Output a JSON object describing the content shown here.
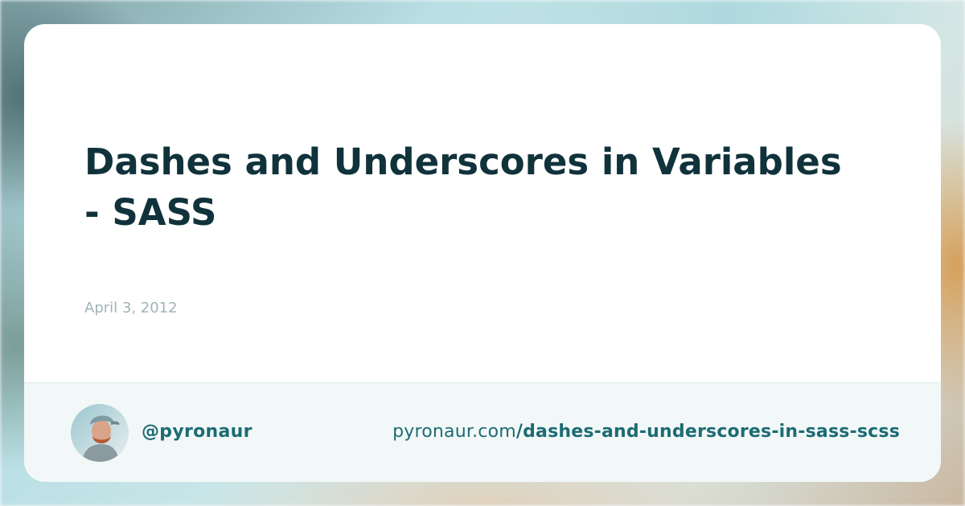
{
  "post": {
    "title": "Dashes and Underscores in Variables - SASS",
    "date": "April 3, 2012"
  },
  "footer": {
    "handle": "@pyronaur",
    "url_domain": "pyronaur.com",
    "url_path": "/dashes-and-underscores-in-sass-scss",
    "avatar_icon": "profile-photo-avatar"
  },
  "colors": {
    "title": "#10323b",
    "date": "#9fb3b6",
    "accent": "#1d6b73",
    "footer_bg": "#f2f8f8",
    "card_bg": "#ffffff"
  }
}
